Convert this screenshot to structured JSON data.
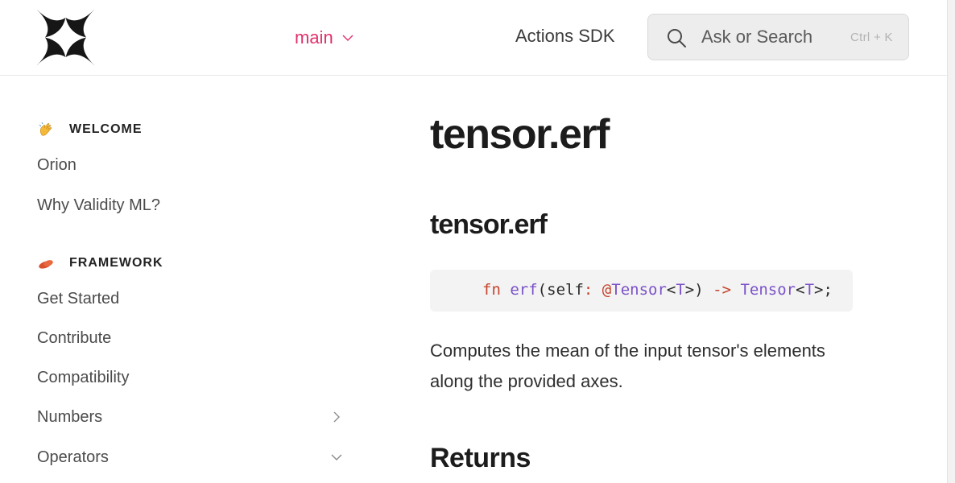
{
  "header": {
    "branch_label": "main",
    "actions_link": "Actions SDK",
    "search": {
      "placeholder": "Ask or Search",
      "shortcut": "Ctrl + K"
    },
    "accent_color": "#e0306b"
  },
  "sidebar": {
    "sections": [
      {
        "title": "WELCOME",
        "icon": "waving-hand-icon",
        "items": [
          "Orion",
          "Why Validity ML?"
        ]
      },
      {
        "title": "FRAMEWORK",
        "icon": "sausage-icon",
        "items": [
          "Get Started",
          "Contribute",
          "Compatibility",
          "Numbers",
          "Operators"
        ]
      }
    ]
  },
  "main": {
    "page_title": "tensor.erf",
    "section_title": "tensor.erf",
    "code": {
      "kw_fn": "fn",
      "fn_name": "erf",
      "open": "(",
      "self": "self",
      "colon": ":",
      "at": "@",
      "type1": "Tensor",
      "lt1": "<",
      "t1": "T",
      "gt1": ">)",
      "arrow": "->",
      "type2": "Tensor",
      "lt2": "<",
      "t2": "T",
      "end": ">;"
    },
    "description": "Computes the mean of the input tensor's elements along the provided axes.",
    "returns_title": "Returns"
  }
}
